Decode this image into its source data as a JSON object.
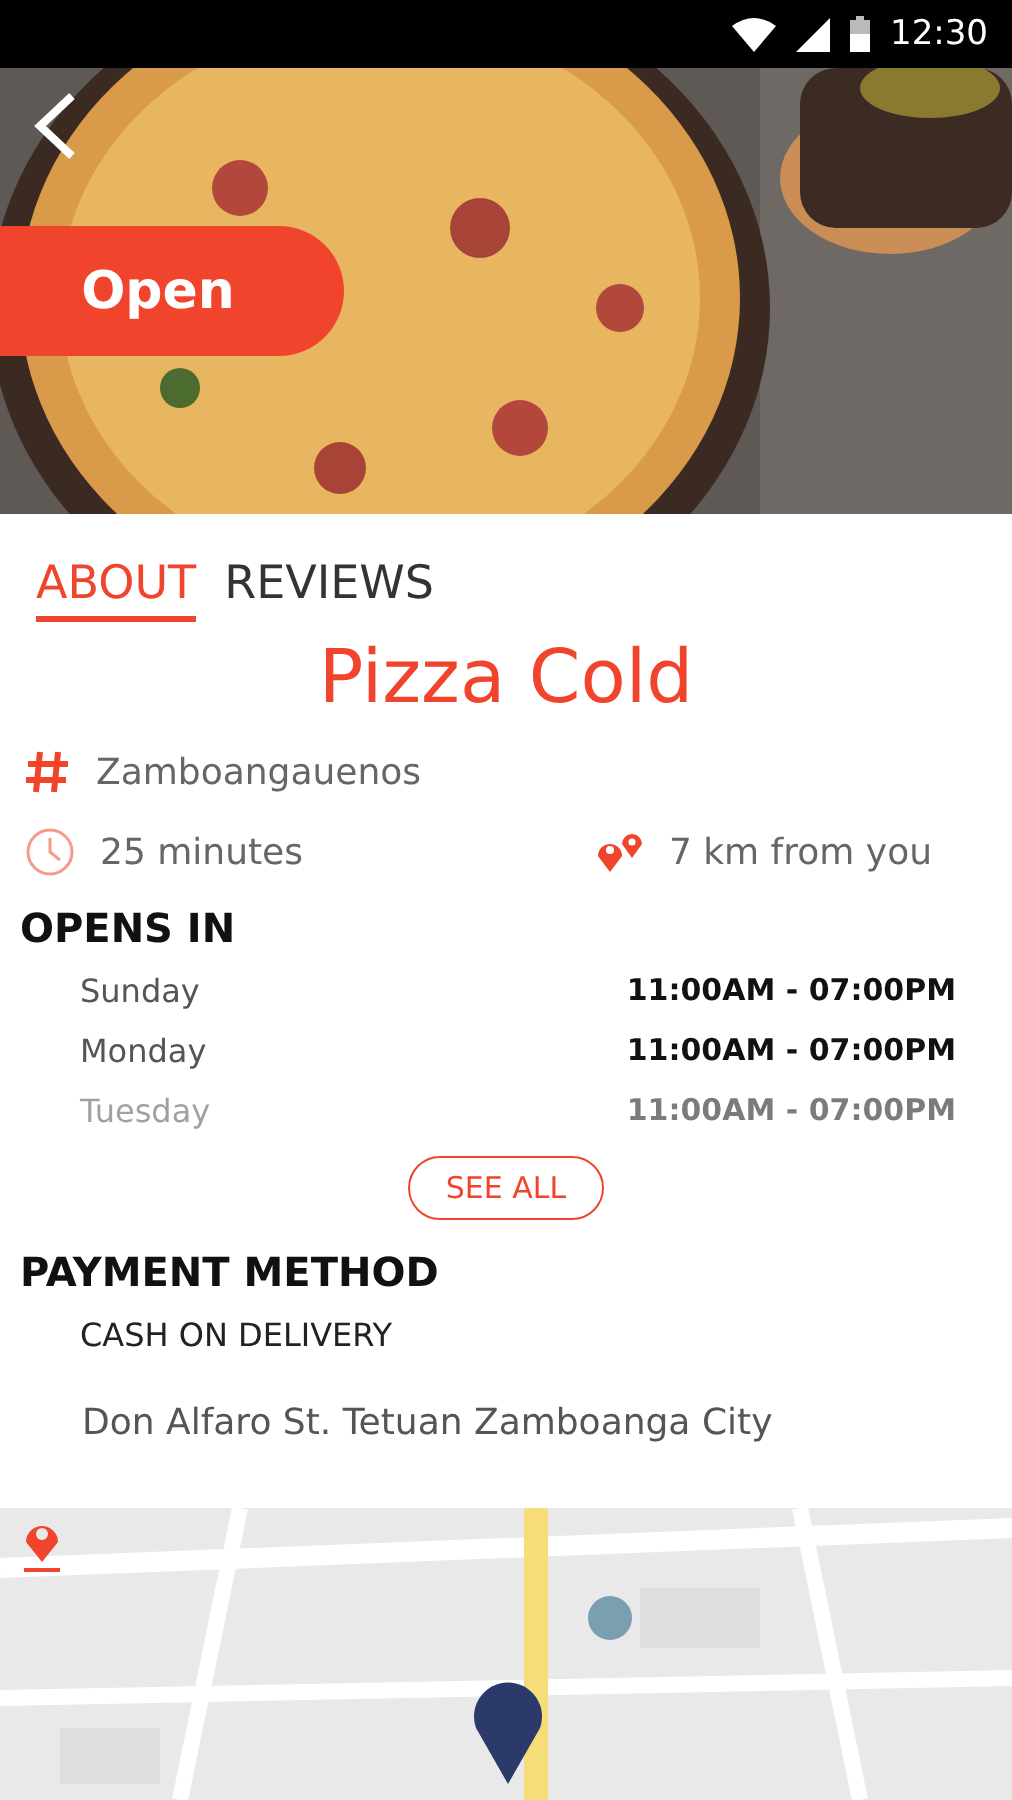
{
  "status_bar": {
    "time": "12:30"
  },
  "hero": {
    "badge": "Open"
  },
  "tabs": [
    {
      "label": "ABOUT",
      "selected": true
    },
    {
      "label": "REVIEWS",
      "selected": false
    }
  ],
  "name": "Pizza Cold",
  "category": "Zamboangauenos",
  "delivery_time": "25 minutes",
  "distance": "7 km from you",
  "hours": {
    "title": "OPENS IN",
    "rows": [
      {
        "day": "Sunday",
        "time": "11:00AM - 07:00PM",
        "faded": false
      },
      {
        "day": "Monday",
        "time": "11:00AM - 07:00PM",
        "faded": false
      },
      {
        "day": "Tuesday",
        "time": "11:00AM - 07:00PM",
        "faded": true
      }
    ],
    "button": "SEE ALL"
  },
  "payment": {
    "title": "PAYMENT METHOD",
    "method": "CASH ON DELIVERY"
  },
  "address": "Don Alfaro St. Tetuan Zamboanga City"
}
